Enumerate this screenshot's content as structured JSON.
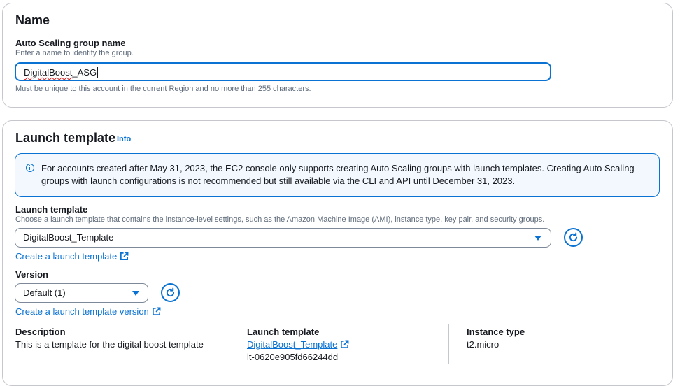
{
  "name_section": {
    "title": "Name",
    "field_label": "Auto Scaling group name",
    "field_description": "Enter a name to identify the group.",
    "field_value_part1": "DigitalBoost",
    "field_value_part2": "_ASG",
    "field_constraint": "Must be unique to this account in the current Region and no more than 255 characters."
  },
  "launch_section": {
    "title": "Launch template",
    "info_link": "Info",
    "alert": {
      "icon": "info-circle-icon",
      "text": "For accounts created after May 31, 2023, the EC2 console only supports creating Auto Scaling groups with launch templates. Creating Auto Scaling groups with launch configurations is not recommended but still available via the CLI and API until December 31, 2023."
    },
    "template_field": {
      "label": "Launch template",
      "description": "Choose a launch template that contains the instance-level settings, such as the Amazon Machine Image (AMI), instance type, key pair, and security groups.",
      "selected": "DigitalBoost_Template",
      "create_link": "Create a launch template"
    },
    "version_field": {
      "label": "Version",
      "selected": "Default (1)",
      "create_link": "Create a launch template version"
    },
    "details": {
      "description_label": "Description",
      "description_value": "This is a template for the digital boost template",
      "template_label": "Launch template",
      "template_link": "DigitalBoost_Template",
      "template_id": "lt-0620e905fd66244dd",
      "instance_type_label": "Instance type",
      "instance_type_value": "t2.micro"
    }
  },
  "colors": {
    "accent": "#0972d3",
    "text": "#16191f",
    "muted": "#5f6b7a",
    "border": "#c6c6cd",
    "alert_bg": "#f2f8fd"
  }
}
